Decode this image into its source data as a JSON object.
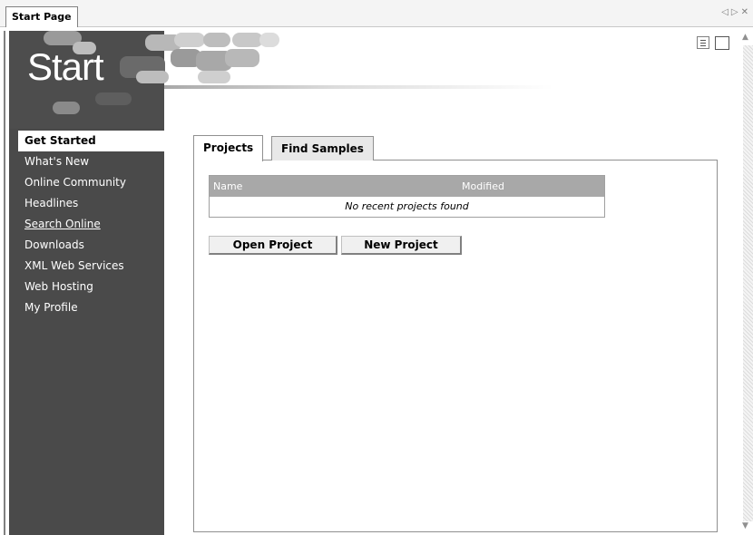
{
  "document_tab": {
    "label": "Start Page"
  },
  "tab_nav": {
    "prev": "◁",
    "next": "▷",
    "close": "✕"
  },
  "banner": {
    "title": "Start"
  },
  "sidebar": {
    "items": [
      {
        "label": "Get Started"
      },
      {
        "label": "What's New"
      },
      {
        "label": "Online Community"
      },
      {
        "label": "Headlines"
      },
      {
        "label": "Search Online"
      },
      {
        "label": "Downloads"
      },
      {
        "label": "XML Web Services"
      },
      {
        "label": "Web Hosting"
      },
      {
        "label": "My Profile"
      }
    ],
    "active_item": "Get Started"
  },
  "view_icons": [
    "list-view-icon",
    "window-icon"
  ],
  "content": {
    "tabs": [
      {
        "label": "Projects",
        "selected": true
      },
      {
        "label": "Find Samples",
        "selected": false
      }
    ],
    "table": {
      "columns": [
        "Name",
        "Modified"
      ],
      "empty_message": "No recent projects found"
    },
    "buttons": {
      "open": "Open Project",
      "new": "New Project"
    }
  },
  "colors": {
    "sidebar_bg": "#4a4a4a",
    "table_header_bg": "#a8a8a8"
  }
}
